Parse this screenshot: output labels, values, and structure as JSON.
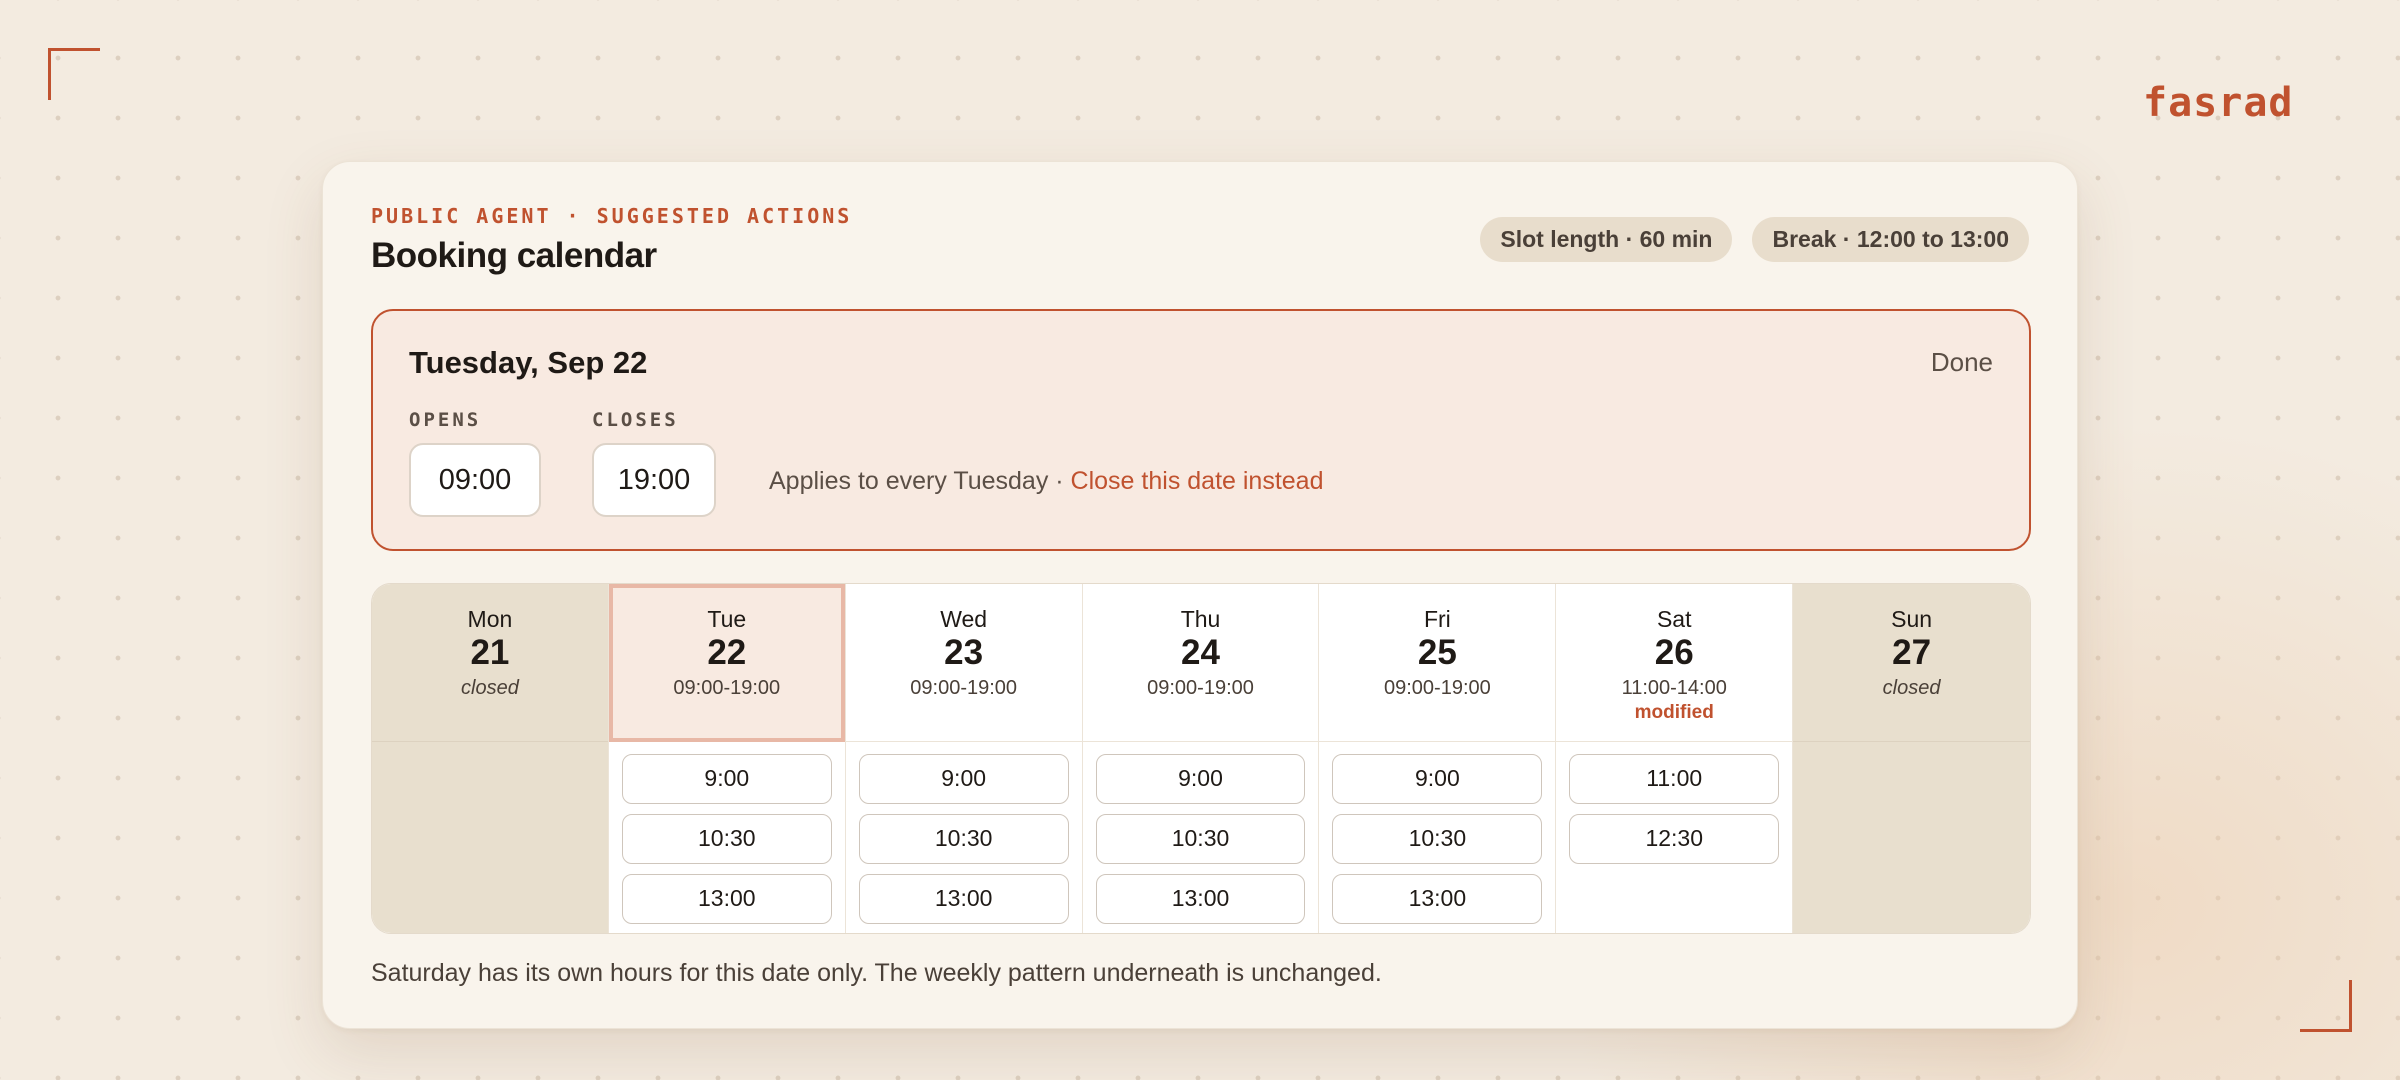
{
  "brand": "fasrad",
  "header": {
    "eyebrow": "PUBLIC AGENT · SUGGESTED ACTIONS",
    "title": "Booking calendar",
    "pills": [
      "Slot length · 60 min",
      "Break · 12:00 to 13:00"
    ]
  },
  "editor": {
    "date": "Tuesday, Sep 22",
    "done_label": "Done",
    "opens_label": "OPENS",
    "opens_value": "09:00",
    "closes_label": "CLOSES",
    "closes_value": "19:00",
    "applies_text": "Applies to every Tuesday · ",
    "close_link": "Close this date instead"
  },
  "days": [
    {
      "name": "Mon",
      "num": "21",
      "closed_text": "closed",
      "slots": []
    },
    {
      "name": "Tue",
      "num": "22",
      "hours": "09:00-19:00",
      "slots": [
        "9:00",
        "10:30",
        "13:00"
      ]
    },
    {
      "name": "Wed",
      "num": "23",
      "hours": "09:00-19:00",
      "slots": [
        "9:00",
        "10:30",
        "13:00"
      ]
    },
    {
      "name": "Thu",
      "num": "24",
      "hours": "09:00-19:00",
      "slots": [
        "9:00",
        "10:30",
        "13:00"
      ]
    },
    {
      "name": "Fri",
      "num": "25",
      "hours": "09:00-19:00",
      "slots": [
        "9:00",
        "10:30",
        "13:00"
      ]
    },
    {
      "name": "Sat",
      "num": "26",
      "hours": "11:00-14:00",
      "modified_text": "modified",
      "slots": [
        "11:00",
        "12:30"
      ]
    },
    {
      "name": "Sun",
      "num": "27",
      "closed_text": "closed",
      "slots": []
    }
  ],
  "footnote": "Saturday has its own hours for this date only. The weekly pattern underneath is unchanged.",
  "colors": {
    "accent": "#c0522f",
    "background": "#f3ebe0",
    "card": "#f9f4ec",
    "editor_bg": "#f8eae1",
    "closed_day": "#e8dfce"
  }
}
